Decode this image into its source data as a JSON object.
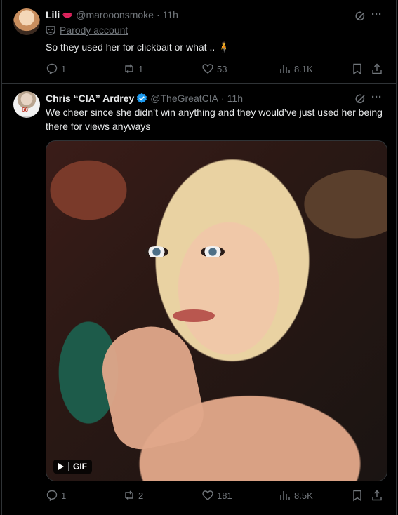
{
  "tweets": [
    {
      "name": "Lili",
      "handle": "@marooonsmoke",
      "time": "11h",
      "badge": "Parody account",
      "text": "So they used her for clickbait or what .. 🧍",
      "replies": "1",
      "reposts": "1",
      "likes": "53",
      "views": "8.1K"
    },
    {
      "name": "Chris “CIA” Ardrey",
      "handle": "@TheGreatCIA",
      "time": "11h",
      "text": "We cheer since she didn’t win anything and they would’ve just used her being there for views anyways",
      "media_label": "GIF",
      "replies": "1",
      "reposts": "2",
      "likes": "181",
      "views": "8.5K"
    }
  ],
  "icons": {
    "reply": "reply-icon",
    "repost": "repost-icon",
    "like": "heart-icon",
    "views": "views-icon",
    "bookmark": "bookmark-icon",
    "share": "share-icon",
    "grok": "grok-icon",
    "more": "more-icon"
  },
  "colors": {
    "background": "#000000",
    "text": "#e7e9ea",
    "muted": "#71767b",
    "border": "#2f3336",
    "verified": "#1d9bf0",
    "lips": "#e0245e"
  }
}
